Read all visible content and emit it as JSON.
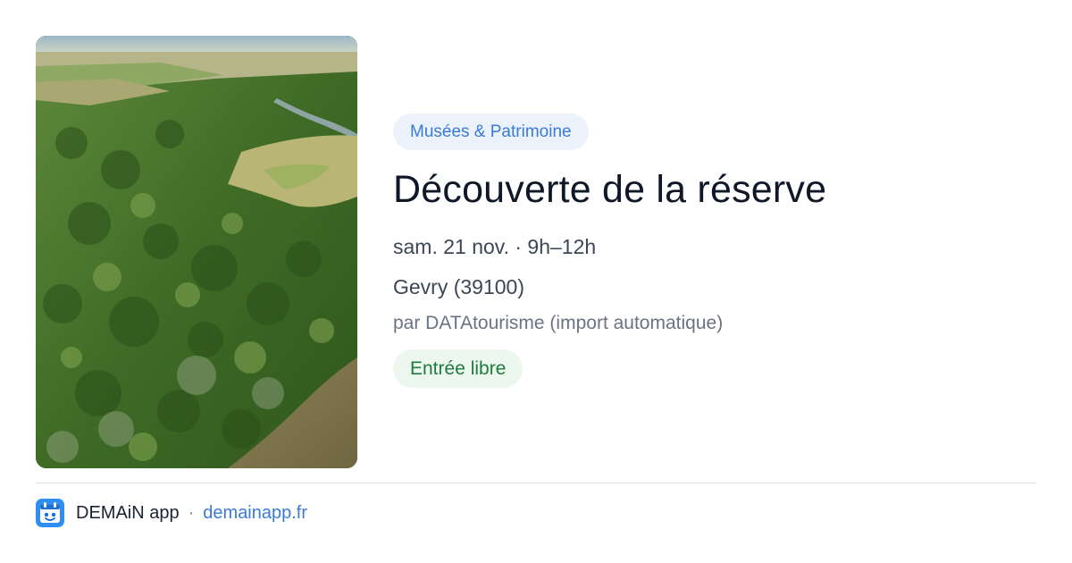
{
  "event": {
    "category": "Musées & Patrimoine",
    "title": "Découverte de la réserve",
    "datetime": "sam. 21 nov. · 9h–12h",
    "location": "Gevry (39100)",
    "source": "par DATAtourisme (import automatique)",
    "price": "Entrée libre"
  },
  "footer": {
    "app_name": "DEMAiN app",
    "separator": "·",
    "url": "demainapp.fr"
  },
  "colors": {
    "category_text": "#3b7ad6",
    "category_bg": "#ebf2fc",
    "price_text": "#1f7a3c",
    "price_bg": "#ecf8ef",
    "link": "#3b7ad6"
  }
}
